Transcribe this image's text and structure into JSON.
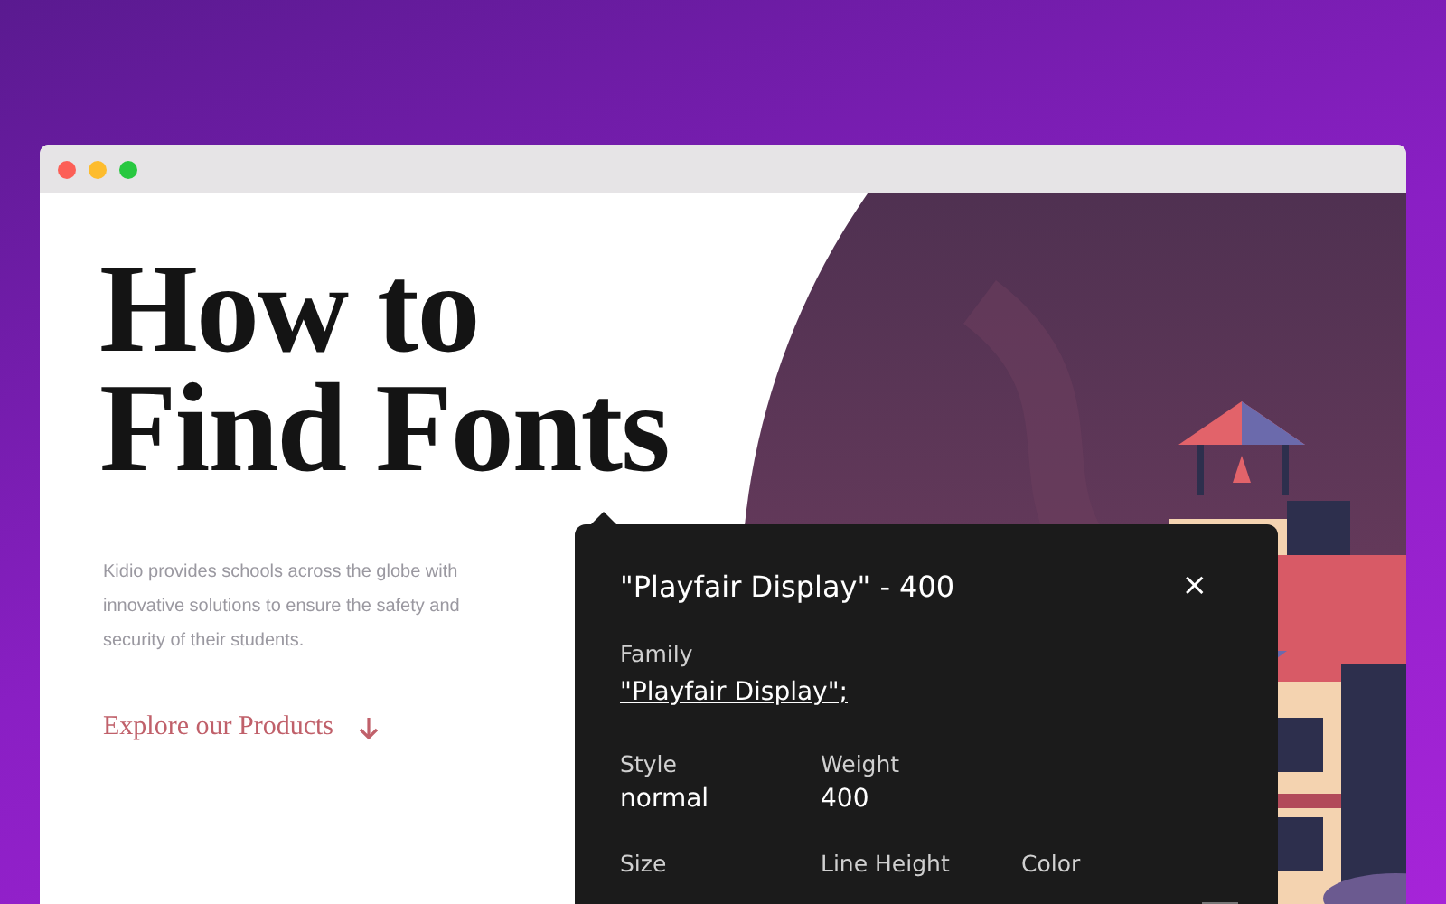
{
  "hero": {
    "heading_lines": [
      "How to",
      "Find Fonts"
    ],
    "description": "Kidio provides schools across the globe with innovative solutions to ensure the safety and security of their students.",
    "link": {
      "label": "Explore our Products"
    }
  },
  "font_popup": {
    "title": "\"Playfair Display\" - 400",
    "close": "×",
    "rows": [
      {
        "fields": [
          {
            "label": "Family",
            "value": "\"Playfair Display\";",
            "kind": "link"
          }
        ]
      },
      {
        "fields": [
          {
            "label": "Style",
            "value": "normal",
            "kind": "text"
          },
          {
            "label": "Weight",
            "value": "400",
            "kind": "text"
          }
        ]
      },
      {
        "fields": [
          {
            "label": "Size",
            "kind": "text"
          },
          {
            "label": "Line Height",
            "kind": "text"
          },
          {
            "label": "Color",
            "kind": "swatch"
          }
        ]
      }
    ]
  }
}
